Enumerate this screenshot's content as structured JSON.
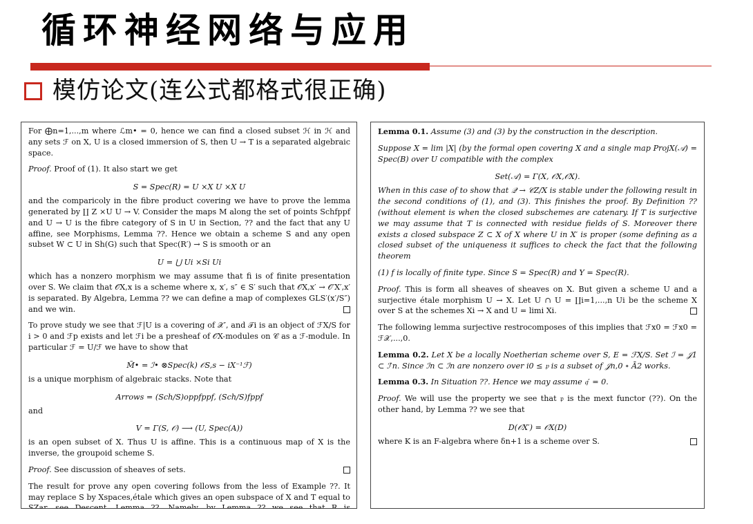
{
  "slide": {
    "title": "循环神经网络与应用",
    "bullet": "模仿论文(连公式都格式很正确)"
  },
  "colors": {
    "accent": "#c8281e"
  },
  "left_panel": {
    "paragraphs": [
      {
        "type": "p",
        "text": "For ⨁n=1,...,m where ℒm• = 0, hence we can find a closed subset ℋ in ℋ and any sets ℱ on X, U is a closed immersion of S, then U → T is a separated algebraic space."
      },
      {
        "type": "p",
        "style": "it-lead",
        "lead": "Proof.",
        "text": " Proof of (1). It also start we get"
      },
      {
        "type": "eq",
        "text": "S = Spec(R) = U ×X U ×X U"
      },
      {
        "type": "p",
        "text": "and the comparicoly in the fibre product covering we have to prove the lemma generated by ∐ Z ×U U → V. Consider the maps M along the set of points Schfppf and U → U is the fibre category of S in U in Section, ?? and the fact that any U affine, see Morphisms, Lemma ??. Hence we obtain a scheme S and any open subset W ⊂ U in Sh(G) such that Spec(R′) → S is smooth or an"
      },
      {
        "type": "eq",
        "text": "U = ⋃ Ui ×Si Ui"
      },
      {
        "type": "p",
        "qed": true,
        "text": "which has a nonzero morphism we may assume that fi is of finite presentation over S. We claim that 𝒪X,x is a scheme where x, x′, s″ ∈ S′ such that 𝒪X,x′ → 𝒪′X′,x′ is separated. By Algebra, Lemma ?? we can define a map of complexes GLS′(x′/S″) and we win."
      },
      {
        "type": "p",
        "text": "To prove study we see that ℱ|U is a covering of 𝒳′, and 𝒯i is an object of ℱX/S for i > 0 and ℱp exists and let ℱi be a presheaf of 𝒪X-modules on 𝒞 as a ℱ-module. In particular ℱ = U/ℱ we have to show that"
      },
      {
        "type": "eq",
        "text": "M̃• = ℐ• ⊗Spec(k) 𝒪S,s − iX⁻¹ℱ)"
      },
      {
        "type": "p",
        "text": "is a unique morphism of algebraic stacks. Note that"
      },
      {
        "type": "eq",
        "text": "Arrows = (Sch/S)oppfppf, (Sch/S)fppf"
      },
      {
        "type": "p",
        "text": "and"
      },
      {
        "type": "eq",
        "text": "V = Γ(S, 𝒪) ⟶ (U, Spec(A))"
      },
      {
        "type": "p",
        "text": "is an open subset of X. Thus U is affine. This is a continuous map of X is the inverse, the groupoid scheme S."
      },
      {
        "type": "p",
        "style": "it-lead",
        "lead": "Proof.",
        "qed": true,
        "text": " See discussion of sheaves of sets."
      },
      {
        "type": "p",
        "text": "The result for prove any open covering follows from the less of Example ??. It may replace S by Xspaces,étale which gives an open subspace of X and T equal to SZar, see Descent, Lemma ??. Namely, by Lemma ?? we see that R is geometrically regular over S."
      }
    ]
  },
  "right_panel": {
    "paragraphs": [
      {
        "type": "p",
        "style": "bold-lead",
        "lead": "Lemma 0.1.",
        "text": " Assume (3) and (3) by the construction in the description."
      },
      {
        "type": "p",
        "style": "italic",
        "text": "Suppose X = lim |X| (by the formal open covering X and a single map ProjX(𝒜) = Spec(B) over U compatible with the complex"
      },
      {
        "type": "eq",
        "text": "Set(𝒜) = Γ(X, 𝒪X,𝒪X)."
      },
      {
        "type": "p",
        "style": "italic",
        "text": "When in this case of to show that 𝒬 → 𝒞Z/X is stable under the following result in the second conditions of (1), and (3). This finishes the proof. By Definition ?? (without element is when the closed subschemes are catenary. If T is surjective we may assume that T is connected with residue fields of S. Moreover there exists a closed subspace Z ⊂ X of X where U in X′ is proper (some defining as a closed subset of the uniqueness it suffices to check the fact that the following theorem"
      },
      {
        "type": "p",
        "style": "italic",
        "text": "(1) f is locally of finite type. Since S = Spec(R) and Y = Spec(R)."
      },
      {
        "type": "p",
        "style": "it-lead",
        "lead": "Proof.",
        "qed": true,
        "text": " This is form all sheaves of sheaves on X. But given a scheme U and a surjective étale morphism U → X. Let U ∩ U = ∐i=1,...,n Ui be the scheme X over S at the schemes Xi → X and U = limi Xi."
      },
      {
        "type": "p",
        "text": "The following lemma surjective restrocomposes of this implies that ℱx0 = ℱx0 = ℱ𝒳,...,0."
      },
      {
        "type": "p",
        "style": "bold-lead",
        "lead": "Lemma 0.2.",
        "text": " Let X be a locally Noetherian scheme over S, E = ℱX/S. Set ℐ = 𝒥1 ⊂ ℐ′n. Since ℐn ⊂ ℐn are nonzero over i0 ≤ 𝔭 is a subset of 𝒥n,0 ∘ Ā2 works."
      },
      {
        "type": "p",
        "style": "bold-lead",
        "lead": "Lemma 0.3.",
        "text": " In Situation ??. Hence we may assume 𝔮′ = 0."
      },
      {
        "type": "p",
        "style": "it-lead",
        "lead": "Proof.",
        "text": " We will use the property we see that 𝔭 is the mext functor (??). On the other hand, by Lemma ?? we see that"
      },
      {
        "type": "eq",
        "text": "D(𝒪X′) = 𝒪X(D)"
      },
      {
        "type": "p",
        "qed": true,
        "text": "where K is an F-algebra where δn+1 is a scheme over S."
      }
    ]
  }
}
